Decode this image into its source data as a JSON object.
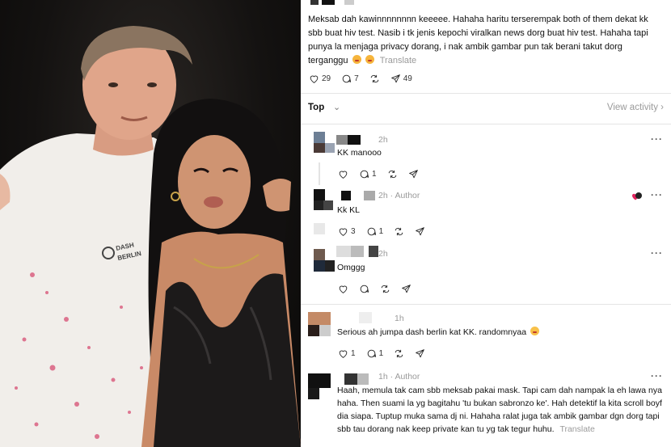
{
  "post": {
    "text": "Meksab dah kawinnnnnnnn keeeee. Hahaha haritu terserempak both of them dekat kk sbb buat hiv test. Nasib i tk jenis kepochi viralkan news dorg buat hiv test. Hahaha tapi punya la menjaga privacy dorang, i nak ambik gambar pun tak berani takut dorg terganggu",
    "translate": "Translate",
    "likes": "29",
    "comments": "7",
    "shares": "49"
  },
  "top_bar": {
    "label": "Top",
    "chevron": "⌄",
    "view_activity": "View activity",
    "view_activity_chevron": "›"
  },
  "comments": [
    {
      "time": "2h",
      "author_tag": "",
      "text": "KK manooo",
      "likes": "",
      "replies": "1"
    },
    {
      "time": "2h",
      "author_tag": "· Author",
      "text": "Kk KL",
      "likes": "3",
      "replies": "1"
    },
    {
      "time": "2h",
      "author_tag": "",
      "text": "Omggg",
      "likes": "",
      "replies": ""
    },
    {
      "time": "1h",
      "author_tag": "",
      "text": "Serious ah jumpa dash berlin kat KK. randomnyaa",
      "likes": "1",
      "replies": "1"
    },
    {
      "time": "1h",
      "author_tag": "· Author",
      "text": "Haah, memula tak cam sbb meksab pakai mask. Tapi cam dah nampak la eh lawa nya haha. Then suami la yg bagitahu 'tu bukan sabronzo ke'. Hah detektif la kita scroll boyf dia siapa. Tuptup muka sama dj ni. Hahaha ralat juga tak ambik gambar dgn dorg tapi sbb tau dorang nak keep private kan tu yg tak tegur huhu.",
      "translate": "Translate"
    }
  ],
  "more_label": "···",
  "photo": {
    "shirt_logo": "DASH BERLIN"
  },
  "colors": {
    "text": "#101010",
    "muted": "#9a9a9a",
    "divider": "#e5e5e5",
    "heart_red": "#e0245e"
  },
  "icons": [
    "heart-icon",
    "comment-icon",
    "repost-icon",
    "share-icon",
    "more-icon"
  ]
}
